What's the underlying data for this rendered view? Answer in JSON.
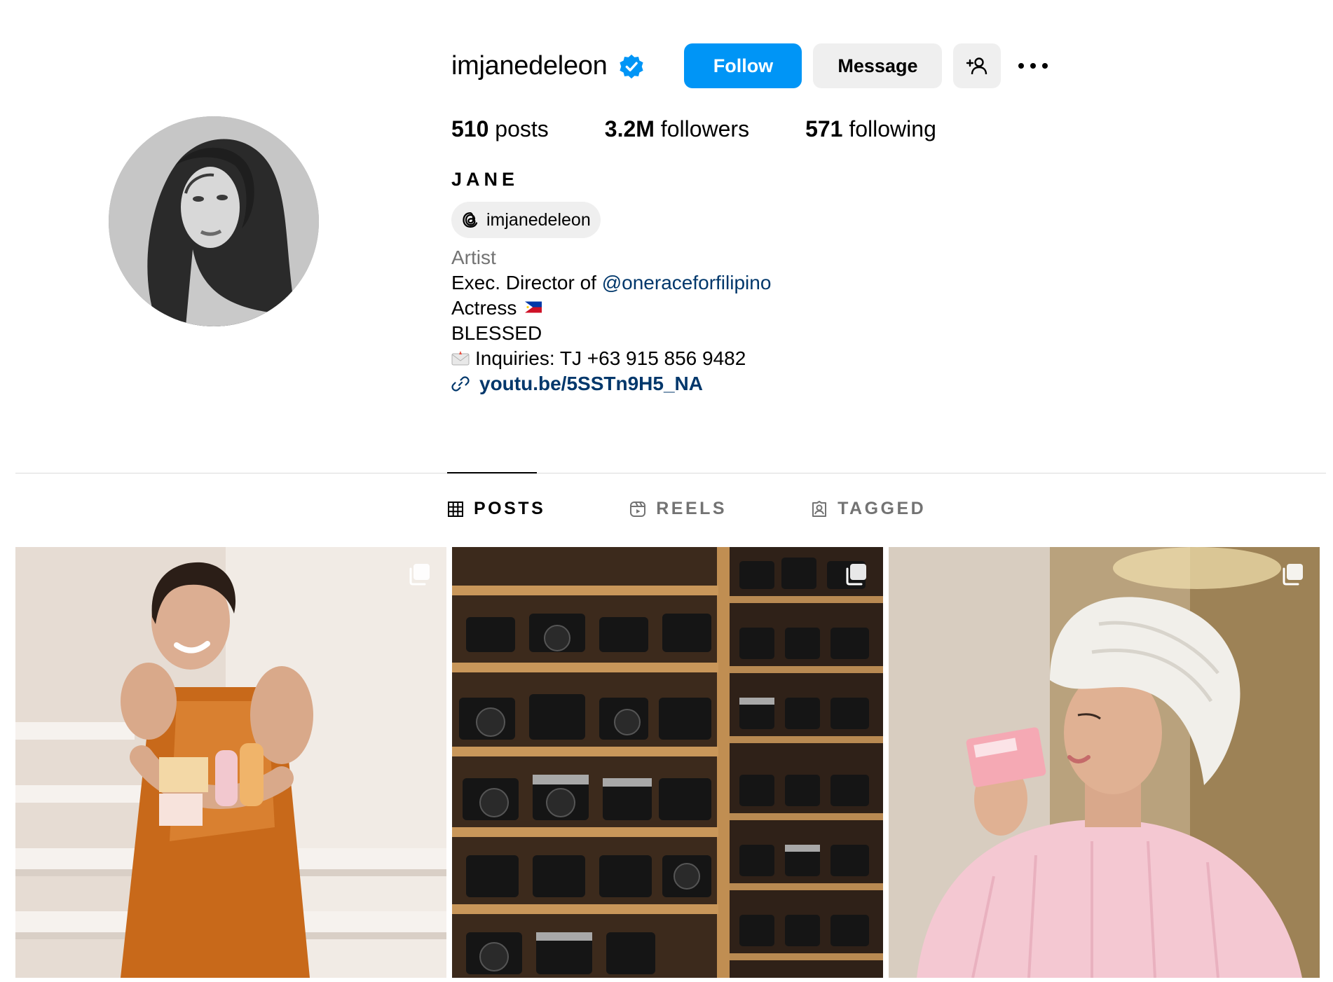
{
  "profile": {
    "username": "imjanedeleon",
    "verified_icon": "verified-badge-icon",
    "follow_label": "Follow",
    "message_label": "Message",
    "suggest_icon": "add-person-icon",
    "more_icon": "more-options-icon",
    "posts_count": "510",
    "posts_label": "posts",
    "followers_count": "3.2M",
    "followers_label": "followers",
    "following_count": "571",
    "following_label": "following",
    "full_name": "JANE",
    "threads_handle": "imjanedeleon",
    "category": "Artist",
    "bio_line1_prefix": "Exec. Director of ",
    "bio_line1_mention": "@oneraceforfilipino",
    "bio_line2": "Actress",
    "bio_line3": "BLESSED",
    "bio_line4": "Inquiries: TJ +63 915 856 9482",
    "link": "youtu.be/5SSTn9H5_NA"
  },
  "tabs": [
    {
      "label": "POSTS",
      "icon": "grid-icon",
      "active": true
    },
    {
      "label": "REELS",
      "icon": "reels-icon",
      "active": false
    },
    {
      "label": "TAGGED",
      "icon": "tagged-icon",
      "active": false
    }
  ],
  "posts": [
    {
      "alt": "Woman in orange satin dress holding Forever Glow products",
      "multi": true
    },
    {
      "alt": "Shelves of vintage cameras with CAMERAS sign",
      "multi": true
    },
    {
      "alt": "Woman in towel and pink pajamas holding Forever Glow soap",
      "multi": true
    }
  ],
  "colors": {
    "accent": "#0095f6",
    "link": "#00376b",
    "secondary_text": "#737373",
    "button_bg": "#efefef"
  }
}
